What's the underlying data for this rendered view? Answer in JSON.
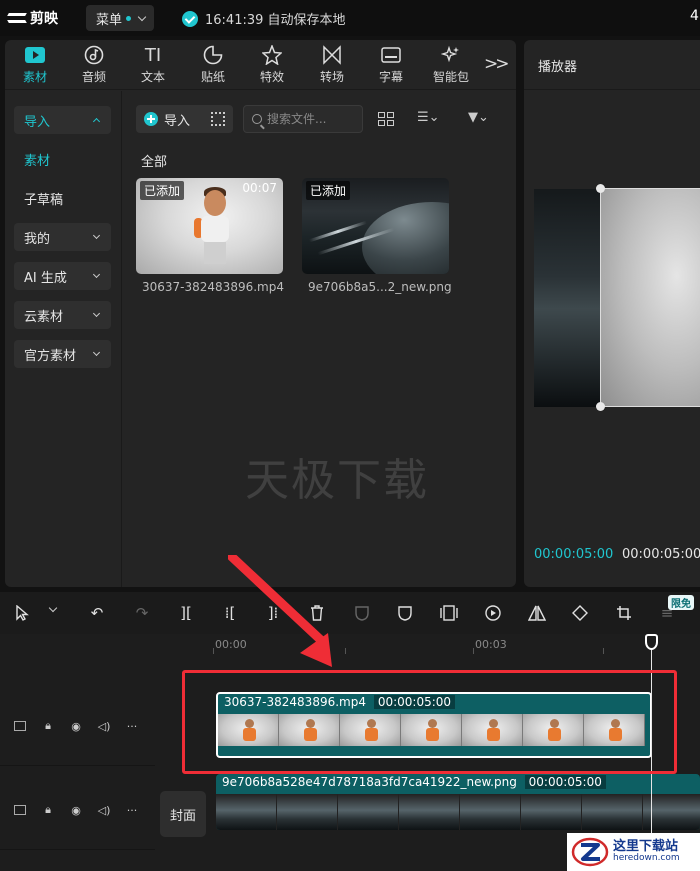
{
  "topbar": {
    "app_name": "剪映",
    "menu_label": "菜单",
    "save_status": "16:41:39 自动保存本地",
    "right_digit": "4"
  },
  "tool_tabs": [
    {
      "label": "素材",
      "icon": "media-icon",
      "active": true
    },
    {
      "label": "音频",
      "icon": "audio-icon"
    },
    {
      "label": "文本",
      "icon": "text-icon"
    },
    {
      "label": "贴纸",
      "icon": "sticker-icon"
    },
    {
      "label": "特效",
      "icon": "effects-icon"
    },
    {
      "label": "转场",
      "icon": "transition-icon"
    },
    {
      "label": "字幕",
      "icon": "subtitle-icon"
    },
    {
      "label": "智能包",
      "icon": "smart-pack-icon"
    }
  ],
  "side_nav": [
    {
      "label": "导入",
      "style": "active-head"
    },
    {
      "label": "素材",
      "style": "sub-active"
    },
    {
      "label": "子草稿",
      "style": "plain"
    },
    {
      "label": "我的",
      "style": "boxed"
    },
    {
      "label": "AI 生成",
      "style": "boxed"
    },
    {
      "label": "云素材",
      "style": "boxed"
    },
    {
      "label": "官方素材",
      "style": "boxed"
    }
  ],
  "media_toolbar": {
    "import_label": "导入",
    "search_placeholder": "搜索文件..."
  },
  "section_label": "全部",
  "media_items": [
    {
      "name": "30637-382483896.mp4",
      "badge": "已添加",
      "duration": "00:07"
    },
    {
      "name": "9e706b8a5...2_new.png",
      "badge": "已添加",
      "duration": ""
    }
  ],
  "watermark": "天极下载",
  "player": {
    "title": "播放器",
    "current_time": "00:00:05:00",
    "total_time": "00:00:05:00"
  },
  "toolbar": {
    "free_badge": "限免"
  },
  "timeline": {
    "ruler_marks": [
      "00:00",
      "00:03"
    ],
    "video_clip": {
      "name": "30637-382483896.mp4",
      "duration": "00:00:05:00"
    },
    "image_clip": {
      "name": "9e706b8a528e47d78718a3fd7ca41922_new.png",
      "duration": "00:00:05:00"
    },
    "cover_label": "封面"
  },
  "corner_logo": {
    "cn": "这里下载站",
    "en": "heredown.com"
  },
  "colors": {
    "accent": "#20c6cf",
    "clip": "#0d5f63",
    "highlight": "#ef2d36"
  }
}
